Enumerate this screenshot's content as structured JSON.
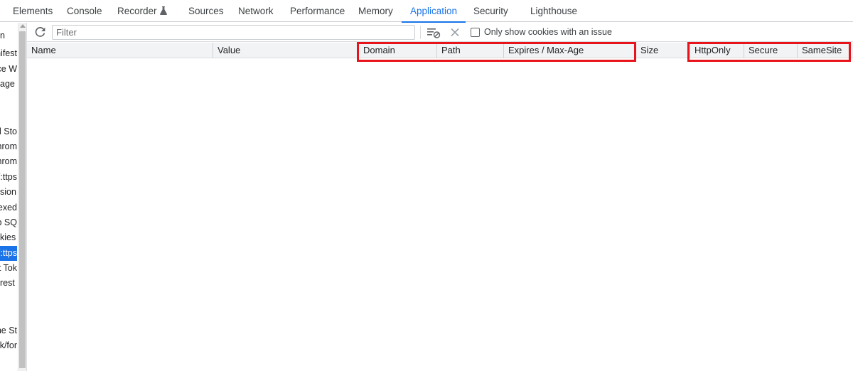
{
  "tabs": [
    {
      "label": "Elements",
      "active": false
    },
    {
      "label": "Console",
      "active": false
    },
    {
      "label": "Recorder",
      "active": false
    },
    {
      "label": "Sources",
      "active": false
    },
    {
      "label": "Network",
      "active": false
    },
    {
      "label": "Performance",
      "active": false
    },
    {
      "label": "Memory",
      "active": false
    },
    {
      "label": "Application",
      "active": true
    },
    {
      "label": "Security",
      "active": false
    },
    {
      "label": "Lighthouse",
      "active": false
    }
  ],
  "sidebar": {
    "items": [
      {
        "label": "n"
      },
      {
        "label": "nifest"
      },
      {
        "label": "vice W"
      },
      {
        "label": "age"
      },
      {
        "label": "al Sto"
      },
      {
        "label": "hrom"
      },
      {
        "label": "hrom"
      },
      {
        "label": "ttps:/"
      },
      {
        "label": "sion"
      },
      {
        "label": "exed"
      },
      {
        "label": "b SQ"
      },
      {
        "label": "kies"
      },
      {
        "label": "ttps:/",
        "selected": true
      },
      {
        "label": "t Tok"
      },
      {
        "label": "rest"
      },
      {
        "label": "he St"
      },
      {
        "label": "k/for"
      }
    ]
  },
  "toolbar": {
    "filter_placeholder": "Filter",
    "filter_value": "",
    "only_issue_label": "Only show cookies with an issue",
    "only_issue_checked": false
  },
  "table": {
    "columns": [
      "Name",
      "Value",
      "Domain",
      "Path",
      "Expires / Max-Age",
      "Size",
      "HttpOnly",
      "Secure",
      "SameSite"
    ],
    "rows": []
  },
  "colors": {
    "accent": "#1a73e8",
    "highlight": "#e8141c",
    "header_bg": "#f1f3f4"
  }
}
